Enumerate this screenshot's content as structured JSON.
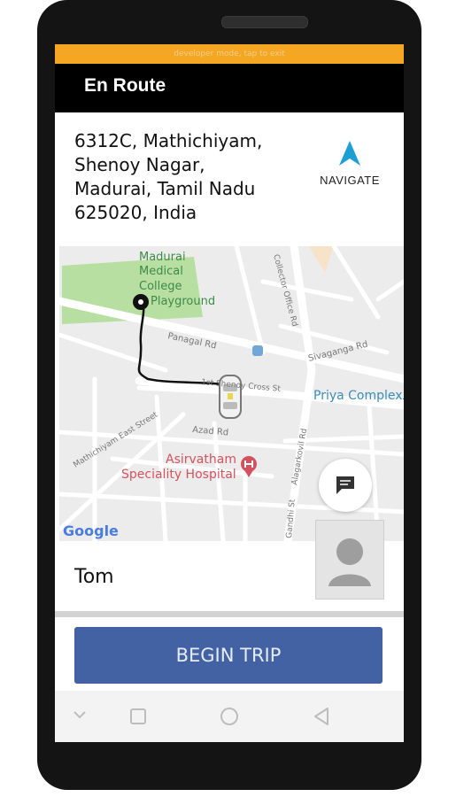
{
  "status": {
    "dev_banner": "developer mode, tap to exit"
  },
  "header": {
    "title": "En Route"
  },
  "destination": {
    "address_lines": [
      "6312C, Mathichiyam,",
      "Shenoy Nagar,",
      "Madurai, Tamil Nadu",
      "625020, India"
    ],
    "navigate_label": "NAVIGATE"
  },
  "map": {
    "labels": {
      "college": [
        "Madurai",
        "Medical",
        "College",
        "Playground"
      ],
      "panagal": "Panagal Rd",
      "sivaganga": "Sivaganga Rd",
      "cross": "1st Shenoy Cross St",
      "priya": "Priya Complex",
      "azad": "Azad Rd",
      "mathichiyam": "Mathichiyam East Street",
      "asirvatham": [
        "Asirvatham",
        "Speciality Hospital"
      ],
      "collector": "Collector Office Rd",
      "alagarkovil": "Alagarkovil Rd",
      "gandhi": "Gandhi St",
      "google": "Google"
    }
  },
  "rider": {
    "name": "Tom"
  },
  "actions": {
    "begin_trip": "BEGIN TRIP"
  },
  "colors": {
    "accent": "#4262a4",
    "navigate": "#1e9fd4",
    "dev_banner": "#f5a623",
    "park": "#b8dfa2",
    "hospital": "#d2535e",
    "poi": "#3a8db8"
  }
}
